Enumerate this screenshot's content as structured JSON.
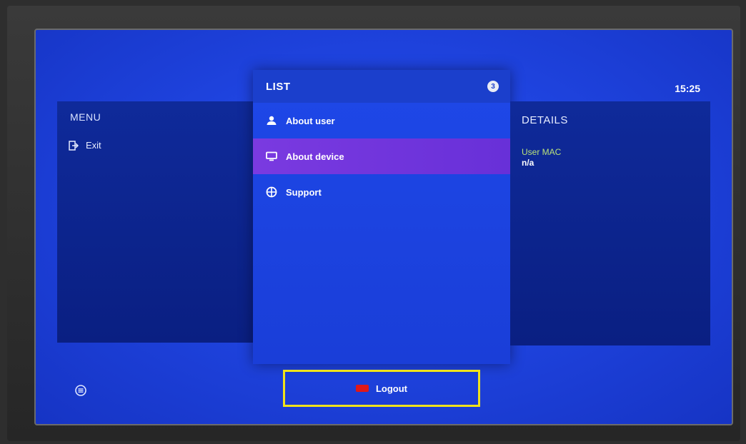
{
  "clock": "15:25",
  "menu": {
    "title": "MENU",
    "items": [
      {
        "label": "Exit",
        "icon": "exit-icon"
      }
    ]
  },
  "list": {
    "title": "LIST",
    "count": "3",
    "items": [
      {
        "label": "About user",
        "icon": "user-icon"
      },
      {
        "label": "About device",
        "icon": "monitor-icon",
        "selected": true
      },
      {
        "label": "Support",
        "icon": "globe-icon"
      }
    ]
  },
  "details": {
    "title": "DETAILS",
    "fields": [
      {
        "label": "User MAC",
        "value": "n/a"
      }
    ]
  },
  "footer": {
    "logout_label": "Logout",
    "logout_key_color": "#e01818",
    "highlight_color": "#f0e21a"
  },
  "colors": {
    "background": "#1f44e0",
    "selected_item": "#7a3ae0",
    "detail_label": "#b9e27a"
  }
}
